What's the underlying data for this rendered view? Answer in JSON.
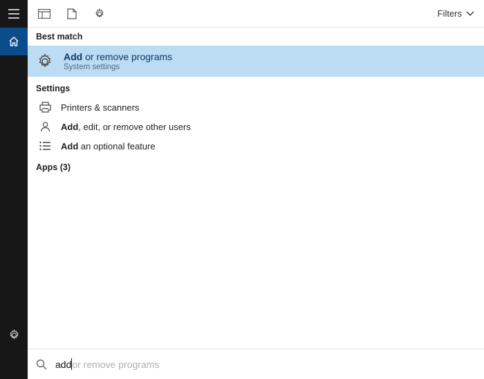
{
  "topbar": {
    "filters_label": "Filters"
  },
  "sections": {
    "best_match": "Best match",
    "settings": "Settings",
    "apps": "Apps (3)"
  },
  "best_match": {
    "title_bold": "Add",
    "title_rest": " or remove programs",
    "subtitle": "System settings"
  },
  "settings_items": [
    {
      "label_bold": "",
      "label_rest": "Printers & scanners",
      "icon": "printer"
    },
    {
      "label_bold": "Add",
      "label_rest": ", edit, or remove other users",
      "icon": "person"
    },
    {
      "label_bold": "Add",
      "label_rest": " an optional feature",
      "icon": "list"
    }
  ],
  "search": {
    "typed": "add",
    "ghost": " or remove programs"
  }
}
